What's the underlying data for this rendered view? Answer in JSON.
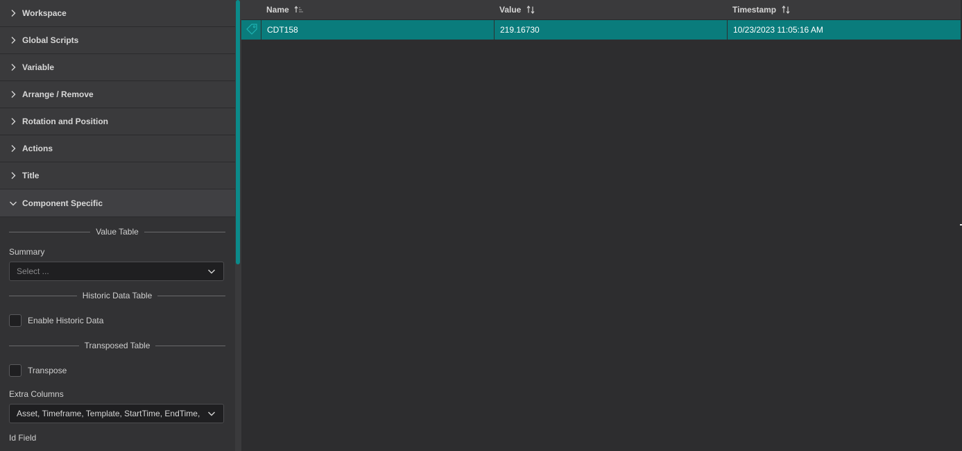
{
  "sidebar": {
    "sections": [
      {
        "label": "Workspace"
      },
      {
        "label": "Global Scripts"
      },
      {
        "label": "Variable"
      },
      {
        "label": "Arrange / Remove"
      },
      {
        "label": "Rotation and Position"
      },
      {
        "label": "Actions"
      },
      {
        "label": "Title"
      }
    ],
    "open_section": {
      "label": "Component Specific"
    },
    "value_table_divider": "Value Table",
    "summary_label": "Summary",
    "summary_placeholder": "Select ...",
    "historic_divider": "Historic Data Table",
    "enable_historic_label": "Enable Historic Data",
    "transposed_divider": "Transposed Table",
    "transpose_label": "Transpose",
    "extra_columns_label": "Extra Columns",
    "extra_columns_value": "Asset, Timeframe, Template, StartTime, EndTime, I",
    "id_field_label": "Id Field"
  },
  "table": {
    "headers": {
      "name": "Name",
      "value": "Value",
      "timestamp": "Timestamp"
    },
    "rows": [
      {
        "icon": "tag-icon",
        "name": "CDT158",
        "value": "219.16730",
        "timestamp": "10/23/2023 11:05:16 AM"
      }
    ]
  },
  "colors": {
    "accent": "#0a7c7c",
    "scrollbar": "#0b8a8a",
    "background": "#2d2d2f",
    "panel": "#323234"
  },
  "icons": {
    "collapsed": "chevron-right-icon",
    "expanded": "chevron-down-icon",
    "dropdown": "chevron-down-icon",
    "sort_asc": "sort-ascending-icon",
    "sort": "sort-icon"
  }
}
